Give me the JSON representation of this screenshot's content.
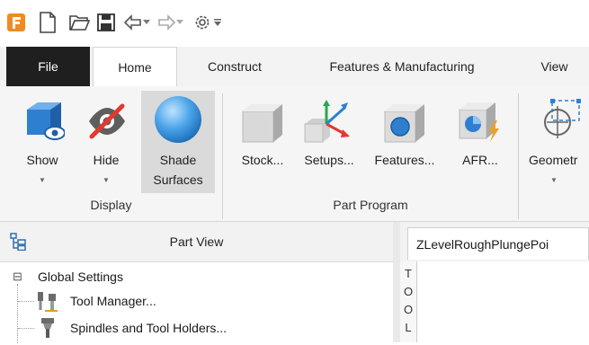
{
  "quick_access": {
    "icons": [
      "app-logo-icon",
      "new-file-icon",
      "open-folder-icon",
      "save-icon",
      "undo-icon",
      "undo-dropdown-icon",
      "redo-icon",
      "redo-dropdown-icon",
      "settings-gear-icon",
      "customize-dropdown-icon"
    ]
  },
  "tabs": [
    "File",
    "Home",
    "Construct",
    "Features & Manufacturing",
    "View"
  ],
  "ribbon": {
    "display": {
      "show_label": "Show",
      "hide_label": "Hide",
      "shade_label_1": "Shade",
      "shade_label_2": "Surfaces",
      "group_label": "Display"
    },
    "part_program": {
      "stock_label": "Stock...",
      "setups_label": "Setups...",
      "features_label": "Features...",
      "afr_label": "AFR...",
      "group_label": "Part Program"
    },
    "geometry_label": "Geometr"
  },
  "part_view": {
    "title": "Part View",
    "tree": [
      {
        "label": "Global Settings",
        "expander": "⊟"
      },
      {
        "label": "Tool Manager..."
      },
      {
        "label": "Spindles and Tool Holders..."
      }
    ]
  },
  "document": {
    "tab_label": "ZLevelRoughPlungePoi",
    "side_tab_letters": [
      "T",
      "O",
      "O",
      "L"
    ]
  },
  "colors": {
    "file_tab_bg": "#1f1f1f",
    "accent_blue": "#2f7fd1",
    "logo_orange": "#f08a24",
    "hide_red": "#e0392f"
  }
}
